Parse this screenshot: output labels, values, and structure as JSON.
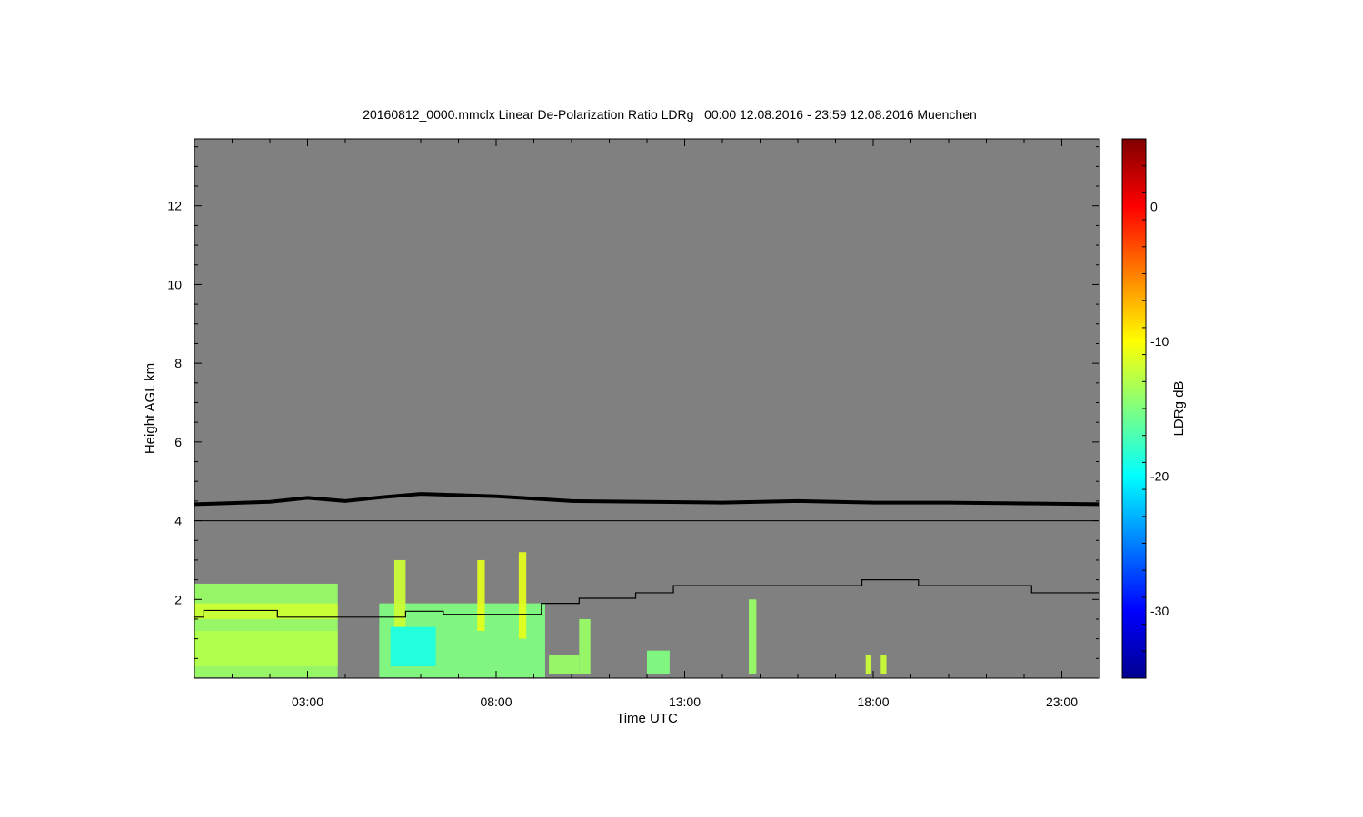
{
  "chart_data": {
    "type": "heatmap",
    "title": "20160812_0000.mmclx Linear De-Polarization Ratio LDRg   00:00 12.08.2016 - 23:59 12.08.2016 Muenchen",
    "xlabel": "Time UTC",
    "ylabel": "Height AGL km",
    "colorbar_label": "LDRg dB",
    "x_unit": "hours UTC",
    "xlim": [
      0.0,
      24.0
    ],
    "ylim": [
      0.0,
      13.7
    ],
    "x_ticks": [
      {
        "value": 3,
        "label": "03:00"
      },
      {
        "value": 8,
        "label": "08:00"
      },
      {
        "value": 13,
        "label": "13:00"
      },
      {
        "value": 18,
        "label": "18:00"
      },
      {
        "value": 23,
        "label": "23:00"
      }
    ],
    "y_ticks": [
      {
        "value": 2,
        "label": "2"
      },
      {
        "value": 4,
        "label": "4"
      },
      {
        "value": 6,
        "label": "6"
      },
      {
        "value": 8,
        "label": "8"
      },
      {
        "value": 10,
        "label": "10"
      },
      {
        "value": 12,
        "label": "12"
      }
    ],
    "colorbar": {
      "range": [
        -35,
        5
      ],
      "ticks": [
        {
          "value": 0,
          "label": "0"
        },
        {
          "value": -10,
          "label": "-10"
        },
        {
          "value": -20,
          "label": "-20"
        },
        {
          "value": -30,
          "label": "-30"
        }
      ],
      "colormap": "jet"
    },
    "colors": {
      "background": "#808080",
      "line": "#000000"
    },
    "reference_line_km": 4.0,
    "noise_level_line": {
      "x": [
        0,
        2,
        3,
        4,
        5,
        6,
        7,
        8,
        9,
        10,
        12,
        14,
        16,
        18,
        20,
        22,
        24
      ],
      "y": [
        4.42,
        4.48,
        4.58,
        4.5,
        4.6,
        4.68,
        4.65,
        4.62,
        4.56,
        4.5,
        4.48,
        4.46,
        4.5,
        4.46,
        4.46,
        4.44,
        4.42
      ]
    },
    "step_line": {
      "x": [
        0,
        0.25,
        2.2,
        3.8,
        5.6,
        6.6,
        9.2,
        10.2,
        11.7,
        12.7,
        17.7,
        19.2,
        22.2,
        24
      ],
      "y": [
        1.55,
        1.72,
        1.55,
        1.55,
        1.7,
        1.62,
        1.9,
        2.03,
        2.17,
        2.35,
        2.5,
        2.35,
        2.17,
        2.17
      ]
    },
    "echo_regions": [
      {
        "t0": 0.0,
        "t1": 3.8,
        "h0": 0.02,
        "h1": 2.4,
        "ldr": -14
      },
      {
        "t0": 0.0,
        "t1": 3.8,
        "h0": 0.3,
        "h1": 1.2,
        "ldr": -13
      },
      {
        "t0": 0.0,
        "t1": 3.8,
        "h0": 1.5,
        "h1": 1.9,
        "ldr": -12
      },
      {
        "t0": 4.9,
        "t1": 9.3,
        "h0": 0.02,
        "h1": 1.9,
        "ldr": -15
      },
      {
        "t0": 5.2,
        "t1": 6.4,
        "h0": 0.3,
        "h1": 1.3,
        "ldr": -19
      },
      {
        "t0": 5.3,
        "t1": 5.6,
        "h0": 1.3,
        "h1": 3.0,
        "ldr": -12
      },
      {
        "t0": 7.5,
        "t1": 7.7,
        "h0": 1.2,
        "h1": 3.0,
        "ldr": -11
      },
      {
        "t0": 8.6,
        "t1": 8.8,
        "h0": 1.0,
        "h1": 3.2,
        "ldr": -11
      },
      {
        "t0": 9.4,
        "t1": 10.2,
        "h0": 0.1,
        "h1": 0.6,
        "ldr": -14
      },
      {
        "t0": 10.2,
        "t1": 10.5,
        "h0": 0.1,
        "h1": 1.5,
        "ldr": -14
      },
      {
        "t0": 12.0,
        "t1": 12.6,
        "h0": 0.1,
        "h1": 0.7,
        "ldr": -15
      },
      {
        "t0": 14.7,
        "t1": 14.9,
        "h0": 0.1,
        "h1": 2.0,
        "ldr": -14
      },
      {
        "t0": 17.8,
        "t1": 17.95,
        "h0": 0.1,
        "h1": 0.6,
        "ldr": -12
      },
      {
        "t0": 18.2,
        "t1": 18.35,
        "h0": 0.1,
        "h1": 0.6,
        "ldr": -12
      }
    ]
  }
}
